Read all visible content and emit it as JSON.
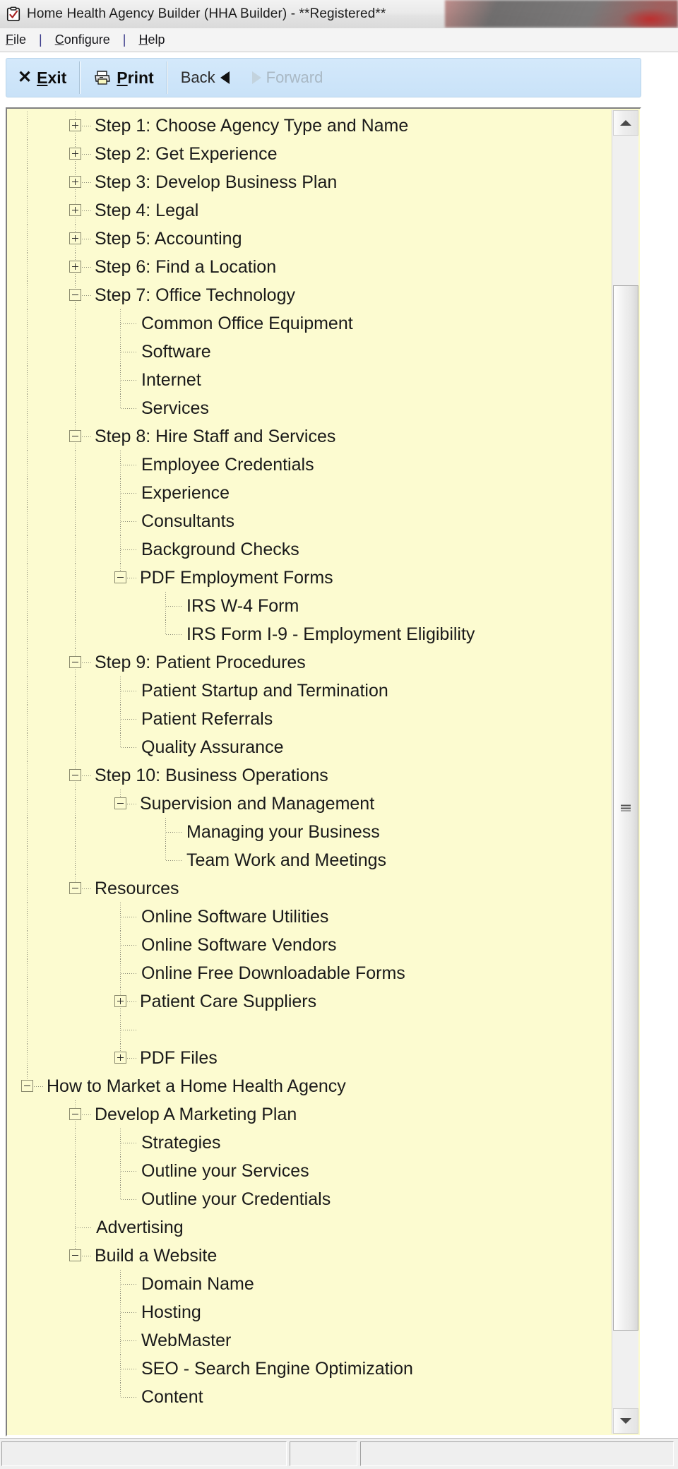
{
  "window": {
    "title": "Home Health Agency Builder (HHA Builder) - **Registered**",
    "icon": "clipboard-check-icon"
  },
  "menubar": {
    "items": [
      {
        "label": "File",
        "accel": "F"
      },
      {
        "label": "Configure",
        "accel": "C"
      },
      {
        "label": "Help",
        "accel": "H"
      }
    ],
    "separator": "|"
  },
  "toolbar": {
    "exit_label": "Exit",
    "exit_icon": "close-x-icon",
    "print_label": "Print",
    "print_icon": "printer-icon",
    "back_label": "Back",
    "back_icon": "triangle-left-icon",
    "forward_label": "Forward",
    "forward_icon": "triangle-right-icon",
    "forward_disabled": true
  },
  "tree": {
    "nodes": [
      {
        "label": "Step 1: Choose Agency Type and Name",
        "level": 1,
        "state": "collapsed"
      },
      {
        "label": "Step 2: Get Experience",
        "level": 1,
        "state": "collapsed"
      },
      {
        "label": "Step 3: Develop Business Plan",
        "level": 1,
        "state": "collapsed"
      },
      {
        "label": "Step 4: Legal",
        "level": 1,
        "state": "collapsed"
      },
      {
        "label": "Step 5: Accounting",
        "level": 1,
        "state": "collapsed"
      },
      {
        "label": "Step 6: Find a Location",
        "level": 1,
        "state": "collapsed"
      },
      {
        "label": "Step 7: Office Technology",
        "level": 1,
        "state": "expanded"
      },
      {
        "label": "Common Office Equipment",
        "level": 2,
        "state": "leaf"
      },
      {
        "label": "Software",
        "level": 2,
        "state": "leaf"
      },
      {
        "label": "Internet",
        "level": 2,
        "state": "leaf"
      },
      {
        "label": "Services",
        "level": 2,
        "state": "leaf"
      },
      {
        "label": "Step 8: Hire Staff and Services",
        "level": 1,
        "state": "expanded"
      },
      {
        "label": "Employee Credentials",
        "level": 2,
        "state": "leaf"
      },
      {
        "label": "Experience",
        "level": 2,
        "state": "leaf"
      },
      {
        "label": "Consultants",
        "level": 2,
        "state": "leaf"
      },
      {
        "label": "Background Checks",
        "level": 2,
        "state": "leaf"
      },
      {
        "label": "PDF Employment Forms",
        "level": 2,
        "state": "expanded"
      },
      {
        "label": "IRS W-4 Form",
        "level": 3,
        "state": "leaf"
      },
      {
        "label": "IRS Form I-9 - Employment Eligibility",
        "level": 3,
        "state": "leaf"
      },
      {
        "label": "Step 9: Patient Procedures",
        "level": 1,
        "state": "expanded"
      },
      {
        "label": "Patient Startup and Termination",
        "level": 2,
        "state": "leaf"
      },
      {
        "label": "Patient Referrals",
        "level": 2,
        "state": "leaf"
      },
      {
        "label": "Quality Assurance",
        "level": 2,
        "state": "leaf"
      },
      {
        "label": "Step 10: Business Operations",
        "level": 1,
        "state": "expanded"
      },
      {
        "label": "Supervision and Management",
        "level": 2,
        "state": "expanded"
      },
      {
        "label": "Managing your Business",
        "level": 3,
        "state": "leaf"
      },
      {
        "label": "Team Work and Meetings",
        "level": 3,
        "state": "leaf"
      },
      {
        "label": "Resources",
        "level": 1,
        "state": "expanded"
      },
      {
        "label": "Online Software Utilities",
        "level": 2,
        "state": "leaf"
      },
      {
        "label": "Online Software Vendors",
        "level": 2,
        "state": "leaf"
      },
      {
        "label": "Online Free Downloadable Forms",
        "level": 2,
        "state": "leaf"
      },
      {
        "label": "Patient Care Suppliers",
        "level": 2,
        "state": "collapsed"
      },
      {
        "label": "",
        "level": 2,
        "state": "blank"
      },
      {
        "label": "PDF Files",
        "level": 2,
        "state": "collapsed"
      },
      {
        "label": "How to Market a Home Health Agency",
        "level": 0,
        "state": "expanded"
      },
      {
        "label": "Develop A Marketing Plan",
        "level": 1,
        "state": "expanded"
      },
      {
        "label": "Strategies",
        "level": 2,
        "state": "leaf"
      },
      {
        "label": "Outline your Services",
        "level": 2,
        "state": "leaf"
      },
      {
        "label": "Outline your Credentials",
        "level": 2,
        "state": "leaf"
      },
      {
        "label": "Advertising",
        "level": 1,
        "state": "leaf"
      },
      {
        "label": "Build a Website",
        "level": 1,
        "state": "expanded"
      },
      {
        "label": "Domain Name",
        "level": 2,
        "state": "leaf"
      },
      {
        "label": "Hosting",
        "level": 2,
        "state": "leaf"
      },
      {
        "label": "WebMaster",
        "level": 2,
        "state": "leaf"
      },
      {
        "label": "SEO - Search Engine Optimization",
        "level": 2,
        "state": "leaf"
      },
      {
        "label": "Content",
        "level": 2,
        "state": "leaf"
      }
    ]
  },
  "scrollbar": {
    "up_icon": "arrow-up-icon",
    "down_icon": "arrow-down-icon",
    "grip_icon": "grip-lines-icon"
  },
  "statusbar": {
    "panels": [
      "",
      "",
      ""
    ]
  },
  "colors": {
    "tree_background": "#fcfbd0",
    "toolbar_background": "#cfe6fa",
    "text": "#1a1a1a",
    "tree_line": "#8a8a78"
  }
}
